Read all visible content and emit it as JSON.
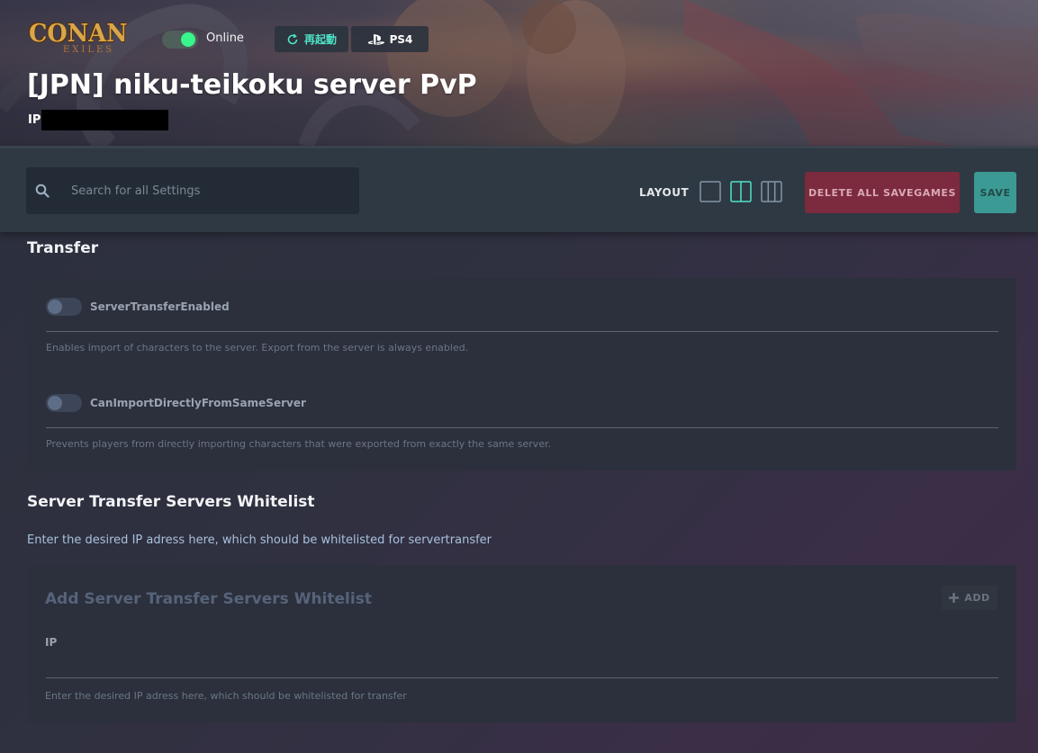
{
  "header": {
    "logo": {
      "brand": "CONAN",
      "sub": "EXILES"
    },
    "status": {
      "label": "Online",
      "enabled": true
    },
    "restart_label": "再起動",
    "platform_label": "PS4",
    "server_name": "[JPN] niku-teikoku server PvP",
    "ip_label": "IP:"
  },
  "toolbar": {
    "search_placeholder": "Search for all Settings",
    "layout_label": "LAYOUT",
    "layout_options": [
      "single-column",
      "two-column",
      "three-column"
    ],
    "layout_selected": "two-column",
    "delete_label": "DELETE ALL SAVEGAMES",
    "save_label": "SAVE"
  },
  "transfer": {
    "title": "Transfer",
    "settings": [
      {
        "name": "ServerTransferEnabled",
        "enabled": false,
        "description": "Enables import of characters to the server. Export from the server is always enabled."
      },
      {
        "name": "CanImportDirectlyFromSameServer",
        "enabled": false,
        "description": "Prevents players from directly importing characters that were exported from exactly the same server."
      }
    ]
  },
  "whitelist": {
    "title": "Server Transfer Servers Whitelist",
    "description": "Enter the desired IP adress here, which should be whitelisted for servertransfer",
    "card_title": "Add Server Transfer Servers Whitelist",
    "add_label": "ADD",
    "field_label": "IP",
    "field_value": "",
    "field_help": "Enter the desired IP adress here, which should be whitelisted for transfer"
  },
  "colors": {
    "accent": "#4fe3c7",
    "toggle_on": "#38f58c",
    "danger": "#7c2a3d",
    "save": "#3b9a93",
    "toolbar_bg": "#2e3943",
    "card_bg": "#2b303c"
  }
}
